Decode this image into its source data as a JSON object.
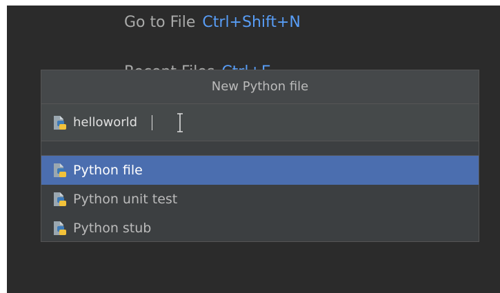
{
  "background_hints": [
    {
      "label": "Go to File",
      "shortcut": "Ctrl+Shift+N"
    },
    {
      "label": "Recent Files",
      "shortcut": "Ctrl+E"
    }
  ],
  "dialog": {
    "title": "New Python file",
    "input_value": "helloworld",
    "options": [
      {
        "label": "Python file",
        "selected": true
      },
      {
        "label": "Python unit test",
        "selected": false
      },
      {
        "label": "Python stub",
        "selected": false
      }
    ]
  },
  "icons": {
    "file_type": "python-file-icon",
    "cursor": "text-cursor-icon"
  },
  "colors": {
    "editor_bg": "#2b2b2b",
    "popup_bg": "#3c3f41",
    "selection": "#4b6eaf",
    "shortcut_text": "#589df6",
    "python_blue": "#3d7ab8",
    "python_yellow": "#f2c23a"
  }
}
